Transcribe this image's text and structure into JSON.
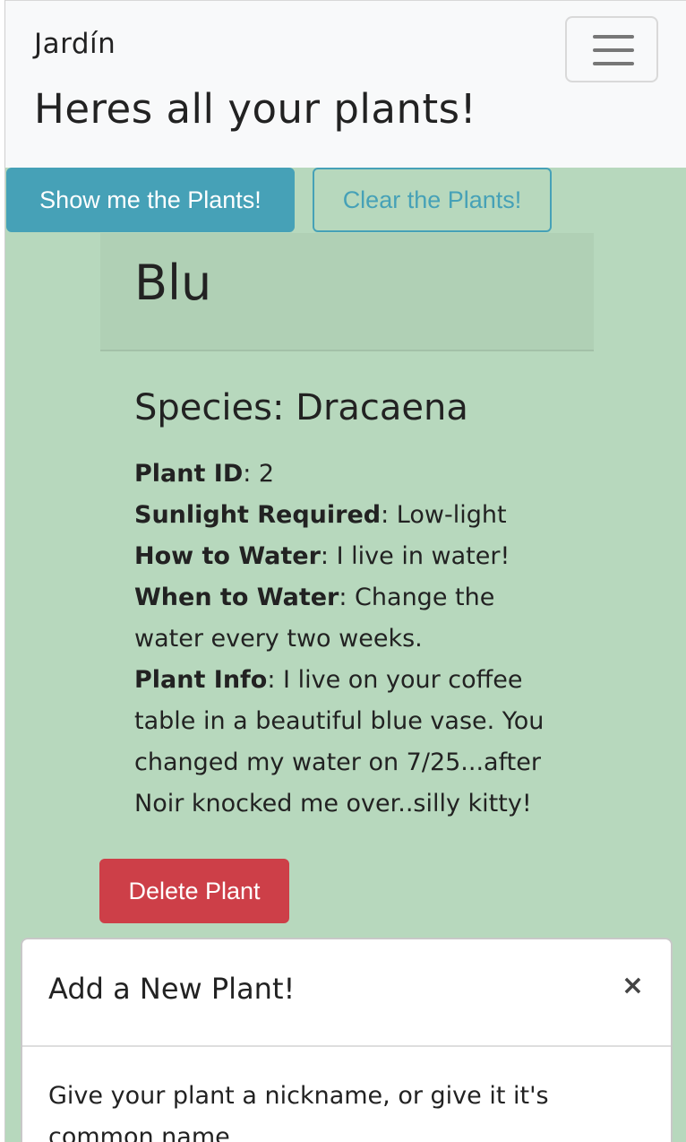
{
  "navbar": {
    "brand": "Jardín",
    "headline": "Heres all your plants!",
    "menu_icon": "hamburger-menu-icon"
  },
  "actions": {
    "show_label": "Show me the Plants!",
    "clear_label": "Clear the Plants!"
  },
  "plant_card": {
    "name": "Blu",
    "species": "Species: Dracaena",
    "details": [
      {
        "label": "Plant ID",
        "value": ": 2"
      },
      {
        "label": "Sunlight Required",
        "value": ": Low-light"
      },
      {
        "label": "How to Water",
        "value": ": I live in water!"
      },
      {
        "label": "When to Water",
        "value": ": Change the water every two weeks."
      },
      {
        "label": "Plant Info",
        "value": ": I live on your coffee table in a beautiful blue vase. You changed my water on 7/25...after Noir knocked me over..silly kitty!"
      }
    ],
    "delete_label": "Delete Plant"
  },
  "modal": {
    "title": "Add a New Plant!",
    "close_symbol": "×",
    "body_text": "Give your plant a nickname, or give it it's common name"
  },
  "colors": {
    "page_bg": "#b7d8bd",
    "navbar_bg": "#f8f9fa",
    "info": "#46a1b7",
    "danger": "#cd3f48"
  }
}
